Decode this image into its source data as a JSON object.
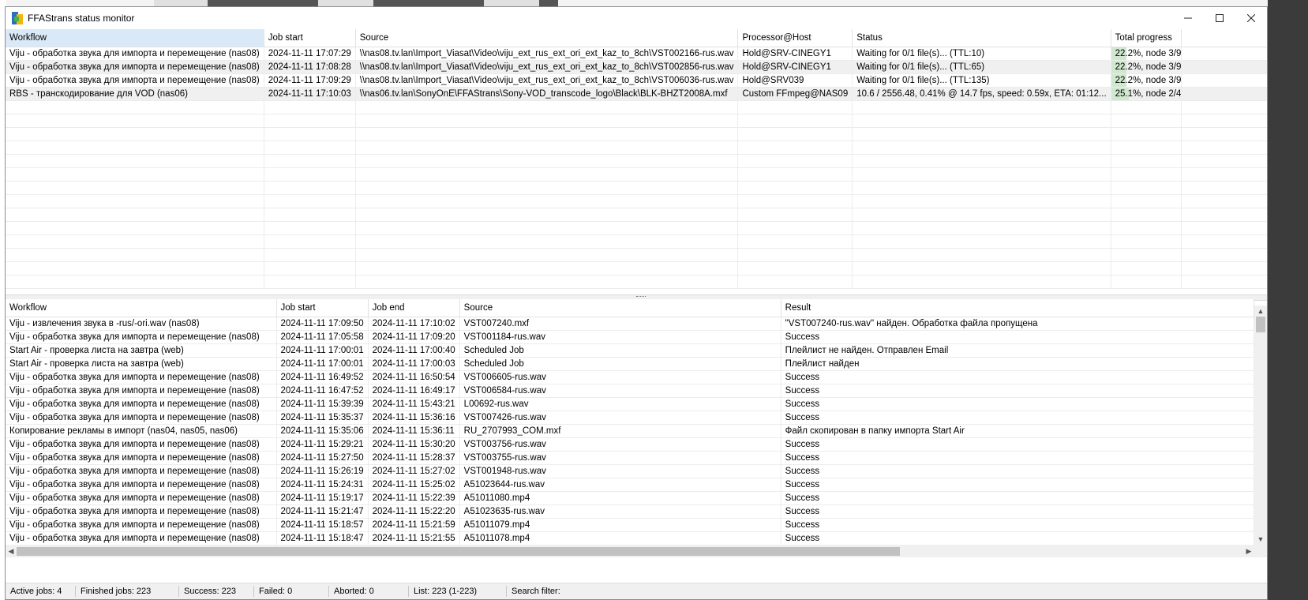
{
  "window": {
    "title": "FFAStrans status monitor"
  },
  "active_table": {
    "columns": [
      "Workflow",
      "Job start",
      "Source",
      "Processor@Host",
      "Status",
      "Total progress"
    ],
    "rows": [
      {
        "workflow": "Viju - обработка звука для импорта и перемещение (nas08)",
        "job_start": "2024-11-11 17:07:29",
        "source": "\\\\nas08.tv.lan\\Import_Viasat\\Video\\viju_ext_rus_ext_ori_ext_kaz_to_8ch\\VST002166-rus.wav",
        "processor": "Hold@SRV-CINEGY1",
        "status": "Waiting for 0/1 file(s)... (TTL:10)",
        "progress_text": "22.2%, node 3/9",
        "progress": 0.222
      },
      {
        "workflow": "Viju - обработка звука для импорта и перемещение (nas08)",
        "job_start": "2024-11-11 17:08:28",
        "source": "\\\\nas08.tv.lan\\Import_Viasat\\Video\\viju_ext_rus_ext_ori_ext_kaz_to_8ch\\VST002856-rus.wav",
        "processor": "Hold@SRV-CINEGY1",
        "status": "Waiting for 0/1 file(s)... (TTL:65)",
        "progress_text": "22.2%, node 3/9",
        "progress": 0.222
      },
      {
        "workflow": "Viju - обработка звука для импорта и перемещение (nas08)",
        "job_start": "2024-11-11 17:09:29",
        "source": "\\\\nas08.tv.lan\\Import_Viasat\\Video\\viju_ext_rus_ext_ori_ext_kaz_to_8ch\\VST006036-rus.wav",
        "processor": "Hold@SRV039",
        "status": "Waiting for 0/1 file(s)... (TTL:135)",
        "progress_text": "22.2%, node 3/9",
        "progress": 0.222
      },
      {
        "workflow": "RBS - транскодирование для VOD (nas06)",
        "job_start": "2024-11-11 17:10:03",
        "source": "\\\\nas06.tv.lan\\SonyOnE\\FFAStrans\\Sony-VOD_transcode_logo\\Black\\BLK-BHZT2008A.mxf",
        "processor": "Custom FFmpeg@NAS09",
        "status": "10.6 / 2556.48, 0.41% @ 14.7 fps, speed: 0.59x, ETA: 01:12...",
        "progress_text": "25.1%, node 2/4",
        "progress": 0.251
      }
    ]
  },
  "finished_table": {
    "columns": [
      "Workflow",
      "Job start",
      "Job end",
      "Source",
      "Result"
    ],
    "rows": [
      {
        "workflow": "Viju - извлечения звука в -rus/-ori.wav (nas08)",
        "job_start": "2024-11-11 17:09:50",
        "job_end": "2024-11-11 17:10:02",
        "source": "VST007240.mxf",
        "result": "\"VST007240-rus.wav\" найден. Обработка файла пропущена"
      },
      {
        "workflow": "Viju - обработка звука для импорта и перемещение (nas08)",
        "job_start": "2024-11-11 17:05:58",
        "job_end": "2024-11-11 17:09:20",
        "source": "VST001184-rus.wav",
        "result": "Success"
      },
      {
        "workflow": "Start Air - проверка листа на завтра (web)",
        "job_start": "2024-11-11 17:00:01",
        "job_end": "2024-11-11 17:00:40",
        "source": "Scheduled Job",
        "result": "Плейлист не найден. Отправлен Email"
      },
      {
        "workflow": "Start Air - проверка листа на завтра (web)",
        "job_start": "2024-11-11 17:00:01",
        "job_end": "2024-11-11 17:00:03",
        "source": "Scheduled Job",
        "result": "Плейлист найден"
      },
      {
        "workflow": "Viju - обработка звука для импорта и перемещение (nas08)",
        "job_start": "2024-11-11 16:49:52",
        "job_end": "2024-11-11 16:50:54",
        "source": "VST006605-rus.wav",
        "result": "Success"
      },
      {
        "workflow": "Viju - обработка звука для импорта и перемещение (nas08)",
        "job_start": "2024-11-11 16:47:52",
        "job_end": "2024-11-11 16:49:17",
        "source": "VST006584-rus.wav",
        "result": "Success"
      },
      {
        "workflow": "Viju - обработка звука для импорта и перемещение (nas08)",
        "job_start": "2024-11-11 15:39:39",
        "job_end": "2024-11-11 15:43:21",
        "source": "L00692-rus.wav",
        "result": "Success"
      },
      {
        "workflow": "Viju - обработка звука для импорта и перемещение (nas08)",
        "job_start": "2024-11-11 15:35:37",
        "job_end": "2024-11-11 15:36:16",
        "source": "VST007426-rus.wav",
        "result": "Success"
      },
      {
        "workflow": "Копирование рекламы в импорт (nas04, nas05, nas06)",
        "job_start": "2024-11-11 15:35:06",
        "job_end": "2024-11-11 15:36:11",
        "source": "RU_2707993_COM.mxf",
        "result": "Файл скопирован в папку импорта Start Air"
      },
      {
        "workflow": "Viju - обработка звука для импорта и перемещение (nas08)",
        "job_start": "2024-11-11 15:29:21",
        "job_end": "2024-11-11 15:30:20",
        "source": "VST003756-rus.wav",
        "result": "Success"
      },
      {
        "workflow": "Viju - обработка звука для импорта и перемещение (nas08)",
        "job_start": "2024-11-11 15:27:50",
        "job_end": "2024-11-11 15:28:37",
        "source": "VST003755-rus.wav",
        "result": "Success"
      },
      {
        "workflow": "Viju - обработка звука для импорта и перемещение (nas08)",
        "job_start": "2024-11-11 15:26:19",
        "job_end": "2024-11-11 15:27:02",
        "source": "VST001948-rus.wav",
        "result": "Success"
      },
      {
        "workflow": "Viju - обработка звука для импорта и перемещение (nas08)",
        "job_start": "2024-11-11 15:24:31",
        "job_end": "2024-11-11 15:25:02",
        "source": "A51023644-rus.wav",
        "result": "Success"
      },
      {
        "workflow": "Viju - обработка звука для импорта и перемещение (nas08)",
        "job_start": "2024-11-11 15:19:17",
        "job_end": "2024-11-11 15:22:39",
        "source": "A51011080.mp4",
        "result": "Success"
      },
      {
        "workflow": "Viju - обработка звука для импорта и перемещение (nas08)",
        "job_start": "2024-11-11 15:21:47",
        "job_end": "2024-11-11 15:22:20",
        "source": "A51023635-rus.wav",
        "result": "Success"
      },
      {
        "workflow": "Viju - обработка звука для импорта и перемещение (nas08)",
        "job_start": "2024-11-11 15:18:57",
        "job_end": "2024-11-11 15:21:59",
        "source": "A51011079.mp4",
        "result": "Success"
      },
      {
        "workflow": "Viju - обработка звука для импорта и перемещение (nas08)",
        "job_start": "2024-11-11 15:18:47",
        "job_end": "2024-11-11 15:21:55",
        "source": "A51011078.mp4",
        "result": "Success"
      }
    ]
  },
  "statusbar": {
    "active_jobs": "Active jobs: 4",
    "finished_jobs": "Finished jobs: 223",
    "success": "Success: 223",
    "failed": "Failed: 0",
    "aborted": "Aborted: 0",
    "list": "List: 223 (1-223)",
    "search_filter": "Search filter:"
  },
  "colors": {
    "progress_fill": "#cfe8cf",
    "sorted_header": "#d9e9f7",
    "alt_row": "#f0f0f0"
  }
}
